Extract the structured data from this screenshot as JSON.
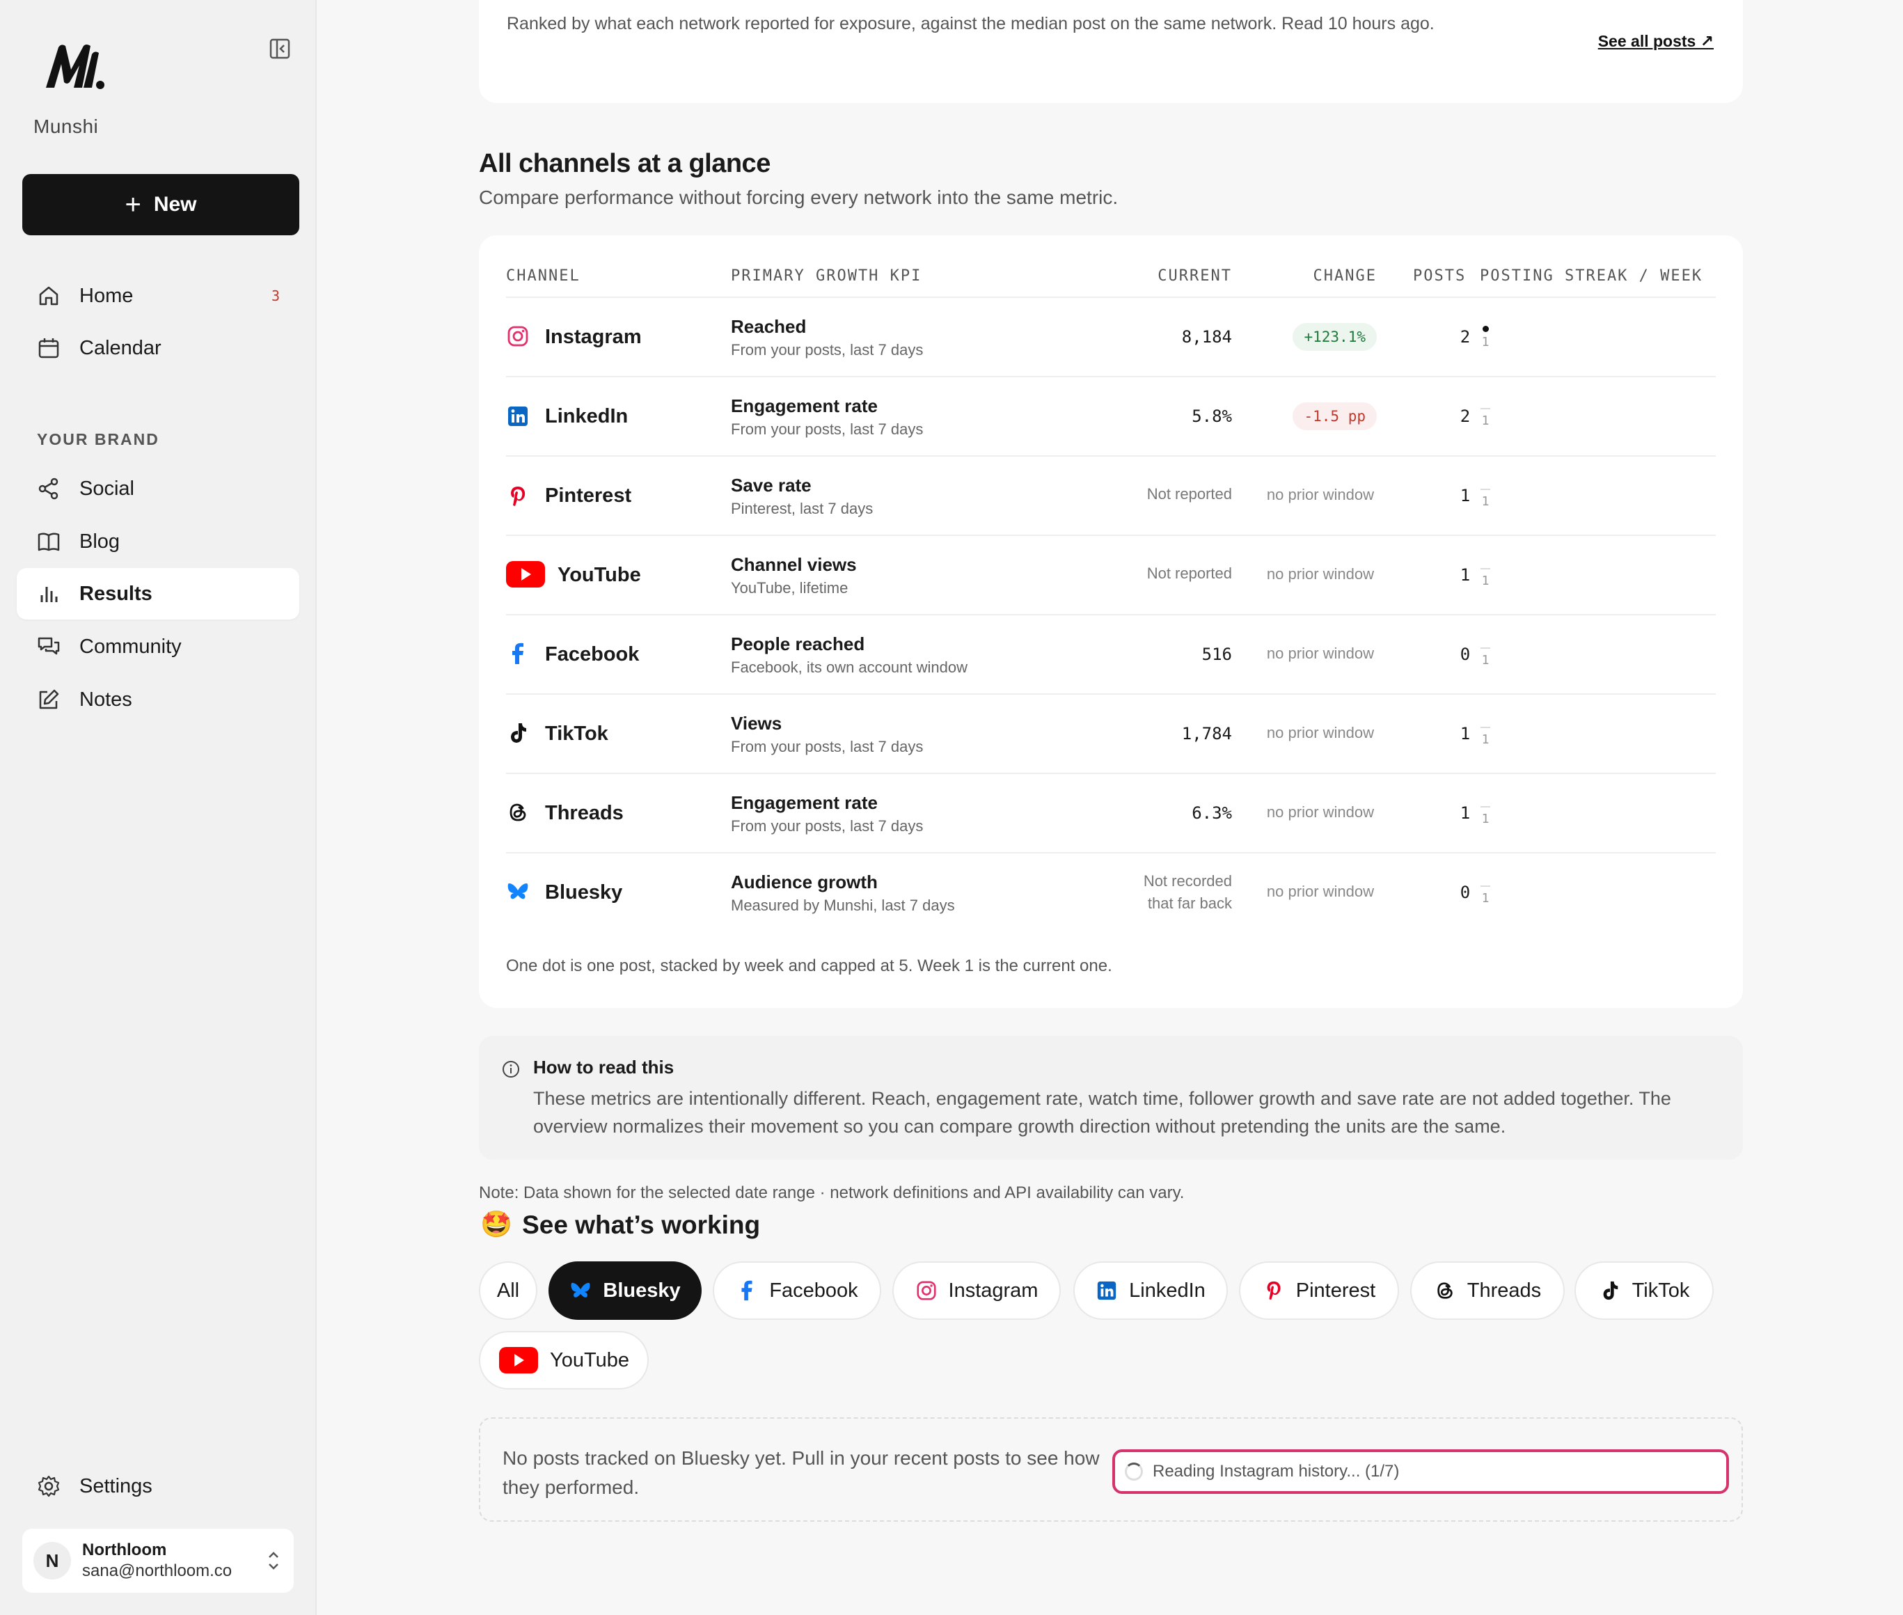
{
  "sidebar": {
    "brand": "Munshi",
    "new_label": "New",
    "nav": [
      {
        "label": "Home",
        "badge": "3"
      },
      {
        "label": "Calendar"
      }
    ],
    "section_label": "YOUR BRAND",
    "brand_nav": [
      {
        "label": "Social"
      },
      {
        "label": "Blog"
      },
      {
        "label": "Results"
      },
      {
        "label": "Community"
      },
      {
        "label": "Notes"
      }
    ],
    "settings_label": "Settings",
    "account": {
      "initial": "N",
      "name": "Northloom",
      "email": "sana@northloom.co"
    }
  },
  "top_card": {
    "description": "Ranked by what each network reported for exposure, against the median post on the same network. Read 10 hours ago.",
    "see_all": "See all posts ↗"
  },
  "glance": {
    "title": "All channels at a glance",
    "subtitle": "Compare performance without forcing every network into the same metric.",
    "headers": {
      "channel": "CHANNEL",
      "kpi": "PRIMARY GROWTH KPI",
      "current": "CURRENT",
      "change": "CHANGE",
      "posts": "POSTS",
      "streak": "POSTING STREAK / WEEK"
    },
    "rows": [
      {
        "channel": "Instagram",
        "kpi": "Reached",
        "kpi_sub": "From your posts, last 7 days",
        "current": "8,184",
        "change": "+123.1%",
        "posts": "2",
        "week": "1"
      },
      {
        "channel": "LinkedIn",
        "kpi": "Engagement rate",
        "kpi_sub": "From your posts, last 7 days",
        "current": "5.8%",
        "change": "-1.5 pp",
        "posts": "2",
        "week": "1"
      },
      {
        "channel": "Pinterest",
        "kpi": "Save rate",
        "kpi_sub": "Pinterest, last 7 days",
        "current": "Not reported",
        "change": "no prior window",
        "posts": "1",
        "week": "1"
      },
      {
        "channel": "YouTube",
        "kpi": "Channel views",
        "kpi_sub": "YouTube, lifetime",
        "current": "Not reported",
        "change": "no prior window",
        "posts": "1",
        "week": "1"
      },
      {
        "channel": "Facebook",
        "kpi": "People reached",
        "kpi_sub": "Facebook, its own account window",
        "current": "516",
        "change": "no prior window",
        "posts": "0",
        "week": "1"
      },
      {
        "channel": "TikTok",
        "kpi": "Views",
        "kpi_sub": "From your posts, last 7 days",
        "current": "1,784",
        "change": "no prior window",
        "posts": "1",
        "week": "1"
      },
      {
        "channel": "Threads",
        "kpi": "Engagement rate",
        "kpi_sub": "From your posts, last 7 days",
        "current": "6.3%",
        "change": "no prior window",
        "posts": "1",
        "week": "1"
      },
      {
        "channel": "Bluesky",
        "kpi": "Audience growth",
        "kpi_sub": "Measured by Munshi, last 7 days",
        "current_line1": "Not recorded",
        "current_line2": "that far back",
        "change": "no prior window",
        "posts": "0",
        "week": "1"
      }
    ],
    "footnote": "One dot is one post, stacked by week and capped at 5. Week 1 is the current one."
  },
  "howto": {
    "title": "How to read this",
    "body": "These metrics are intentionally different. Reach, engagement rate, watch time, follower growth and save rate are not added together. The overview normalizes their movement so you can compare growth direction without pretending the units are the same."
  },
  "note": "Note: Data shown for the selected date range · network definitions and API availability can vary.",
  "working": {
    "emoji": "🤩",
    "title": "See what’s working",
    "chips": [
      "All",
      "Bluesky",
      "Facebook",
      "Instagram",
      "LinkedIn",
      "Pinterest",
      "Threads",
      "TikTok",
      "YouTube"
    ],
    "empty_text": "No posts tracked on Bluesky yet. Pull in your recent posts to see how they performed.",
    "loading_text": "Reading Instagram history... (1/7)"
  },
  "colors": {
    "accent_dark": "#141414",
    "positive": "#1e7a3a",
    "negative": "#c0392b",
    "highlight": "#d6336c"
  }
}
